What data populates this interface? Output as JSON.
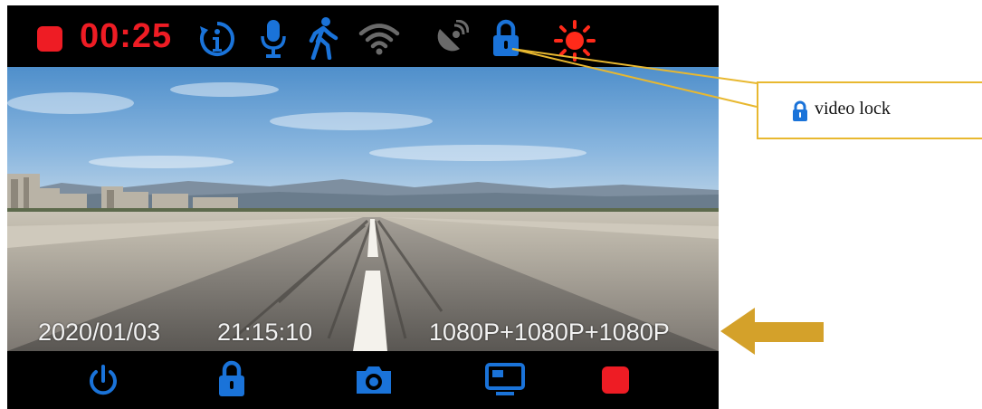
{
  "status_bar": {
    "timer": "00:25",
    "icons": [
      "record-stop-icon",
      "info-icon",
      "microphone-icon",
      "motion-detection-icon",
      "wifi-icon",
      "gps-icon",
      "lock-icon",
      "brightness-icon"
    ]
  },
  "overlay": {
    "date": "2020/01/03",
    "time": "21:15:10",
    "resolution": "1080P+1080P+1080P"
  },
  "bottom_bar": {
    "buttons": [
      "power-button",
      "lock-button",
      "camera-button",
      "display-button",
      "stop-record-button"
    ]
  },
  "callout": {
    "label": "video lock"
  },
  "colors": {
    "accent_blue": "#1a73d9",
    "record_red": "#ee1c24",
    "sun_red": "#ff2a1a",
    "callout_gold": "#e8b830",
    "arrow_gold": "#d4a12a",
    "inactive_gray": "#6a6a6a"
  }
}
